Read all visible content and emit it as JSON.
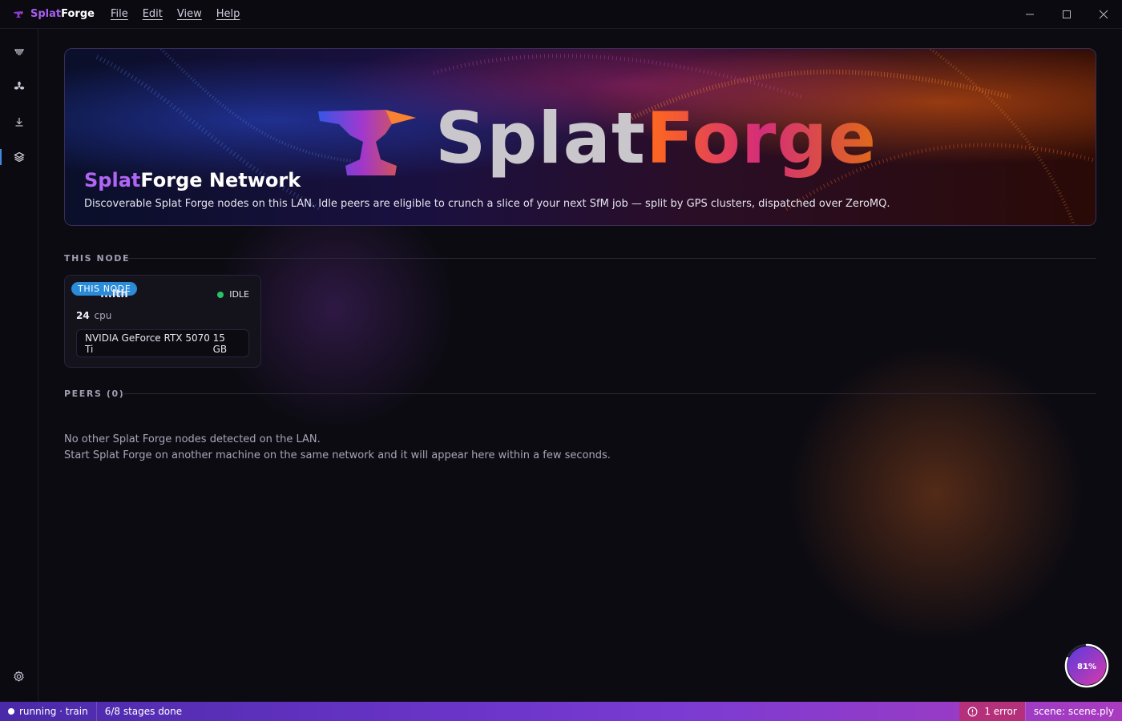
{
  "titlebar": {
    "app_name_part1": "Splat",
    "app_name_part2": "Forge",
    "menu": [
      "File",
      "Edit",
      "View",
      "Help"
    ],
    "window_controls": [
      "minimize-icon",
      "maximize-icon",
      "close-icon"
    ]
  },
  "sidebar": {
    "items": [
      {
        "icon": "stack-icon",
        "active": false
      },
      {
        "icon": "fan-icon",
        "active": false
      },
      {
        "icon": "download-icon",
        "active": false
      },
      {
        "icon": "layers-icon",
        "active": true
      }
    ],
    "bottom_icon": "gear-icon"
  },
  "hero": {
    "logo_part1": "Splat",
    "logo_part2": "Forge",
    "title_part1": "Splat",
    "title_part2": "Forge Network",
    "subtitle": "Discoverable Splat Forge nodes on this LAN. Idle peers are eligible to crunch a slice of your next SfM job — split by GPS clusters, dispatched over ZeroMQ."
  },
  "this_node": {
    "section_label": "THIS NODE",
    "badge": "THIS NODE",
    "name": "...ith",
    "status": "IDLE",
    "status_color": "#27c267",
    "cpu_count": "24",
    "cpu_unit": "cpu",
    "gpu_name": "NVIDIA GeForce RTX 5070 Ti",
    "gpu_mem": "15 GB"
  },
  "peers": {
    "section_label": "PEERS (0)",
    "empty_line1": "No other Splat Forge nodes detected on the LAN.",
    "empty_line2": "Start Splat Forge on another machine on the same network and it will appear here within a few seconds."
  },
  "progress": {
    "value": 0.81,
    "label": "81%"
  },
  "statusbar": {
    "state": "running · train",
    "stages": "6/8 stages done",
    "error": "1 error",
    "scene": "scene: scene.ply"
  },
  "colors": {
    "accent": "#a65ef0",
    "active_indicator": "#3a8dde",
    "badge": "#2a8bd8"
  }
}
